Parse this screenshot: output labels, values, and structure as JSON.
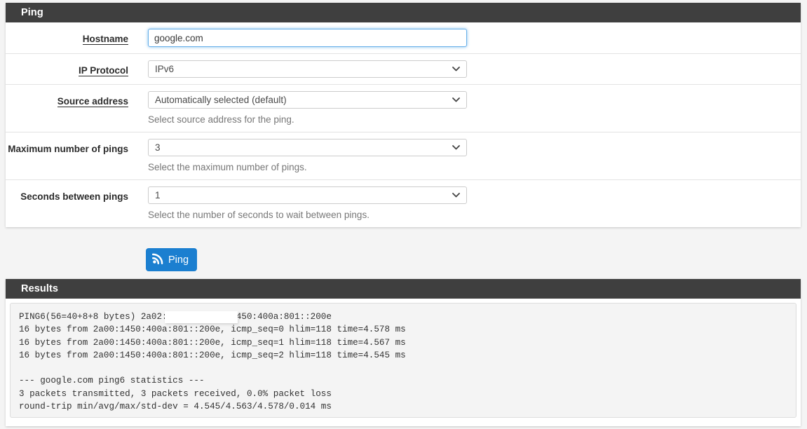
{
  "ping_panel": {
    "title": "Ping",
    "fields": [
      {
        "label": "Hostname",
        "underlined": true,
        "type": "text",
        "value": "google.com",
        "placeholder": "",
        "help": ""
      },
      {
        "label": "IP Protocol",
        "underlined": true,
        "type": "select",
        "value": "IPv6",
        "help": ""
      },
      {
        "label": "Source address",
        "underlined": true,
        "type": "select",
        "value": "Automatically selected (default)",
        "help": "Select source address for the ping."
      },
      {
        "label": "Maximum number of pings",
        "underlined": false,
        "type": "select",
        "value": "3",
        "help": "Select the maximum number of pings."
      },
      {
        "label": "Seconds between pings",
        "underlined": false,
        "type": "select",
        "value": "1",
        "help": "Select the number of seconds to wait between pings."
      }
    ]
  },
  "actions": {
    "ping_button_label": "Ping",
    "ping_button_icon": "rss-signal-icon",
    "ping_button_color": "#1b7fd0"
  },
  "results_panel": {
    "title": "Results",
    "output_line_1_prefix": "PING6(56=40+8+8 bytes) 2a02:1",
    "output_line_1_suffix": ": --> 2a00:1450:400a:801::200e",
    "output_redacted": true,
    "output_lines": [
      "16 bytes from 2a00:1450:400a:801::200e, icmp_seq=0 hlim=118 time=4.578 ms",
      "16 bytes from 2a00:1450:400a:801::200e, icmp_seq=1 hlim=118 time=4.567 ms",
      "16 bytes from 2a00:1450:400a:801::200e, icmp_seq=2 hlim=118 time=4.545 ms",
      "",
      "--- google.com ping6 statistics ---",
      "3 packets transmitted, 3 packets received, 0.0% packet loss",
      "round-trip min/avg/max/std-dev = 4.545/4.563/4.578/0.014 ms"
    ]
  },
  "theme": {
    "header_bg": "#3f3f3f",
    "page_bg": "#f4f4f4",
    "focus_border": "#66afe9"
  }
}
